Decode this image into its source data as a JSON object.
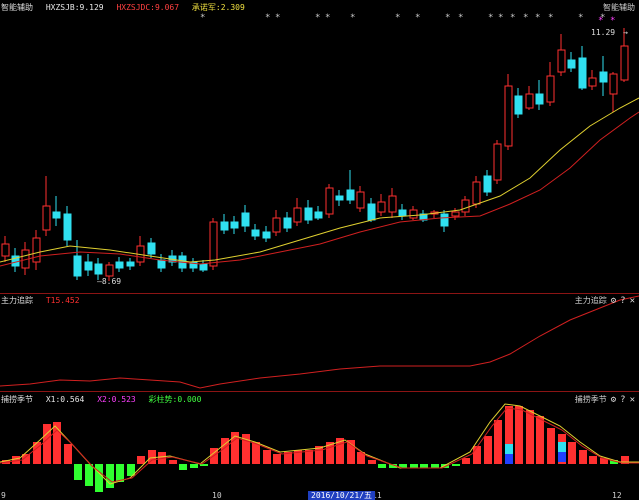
{
  "main": {
    "title": "智能辅助",
    "title_right": "智能辅助",
    "indicators": [
      {
        "label": "HXZSJB:9.129",
        "color": "#e8e8e8"
      },
      {
        "label": "HXZSJDC:9.067",
        "color": "#ff4040"
      },
      {
        "label": "承诺军:2.309",
        "color": "#f0e040"
      }
    ],
    "high_label": "11.29",
    "low_label": "8.69",
    "star_glyph": "*"
  },
  "sub1": {
    "title": "主力追踪",
    "value_label": "T15.452",
    "title_right": "主力追踪"
  },
  "sub2": {
    "title": "捕捞季节",
    "indicators": [
      {
        "label": "X1:0.564",
        "color": "#e8e8e8"
      },
      {
        "label": "X2:0.523",
        "color": "#ff40ff"
      },
      {
        "label": "彩柱势:0.000",
        "color": "#40ff40"
      }
    ],
    "title_right": "捕捞季节"
  },
  "xaxis": {
    "labels": [
      "9",
      "10",
      "11",
      "12"
    ],
    "date_box": "2016/10/21/五"
  },
  "icons": {
    "gear": "⚙",
    "help": "?",
    "close": "✕"
  },
  "colors": {
    "up": "#ff3030",
    "down": "#30e0f0",
    "ma_short": "#e0d030",
    "ma_long": "#d02020",
    "green": "#30ff30",
    "blue": "#2040ff"
  }
}
